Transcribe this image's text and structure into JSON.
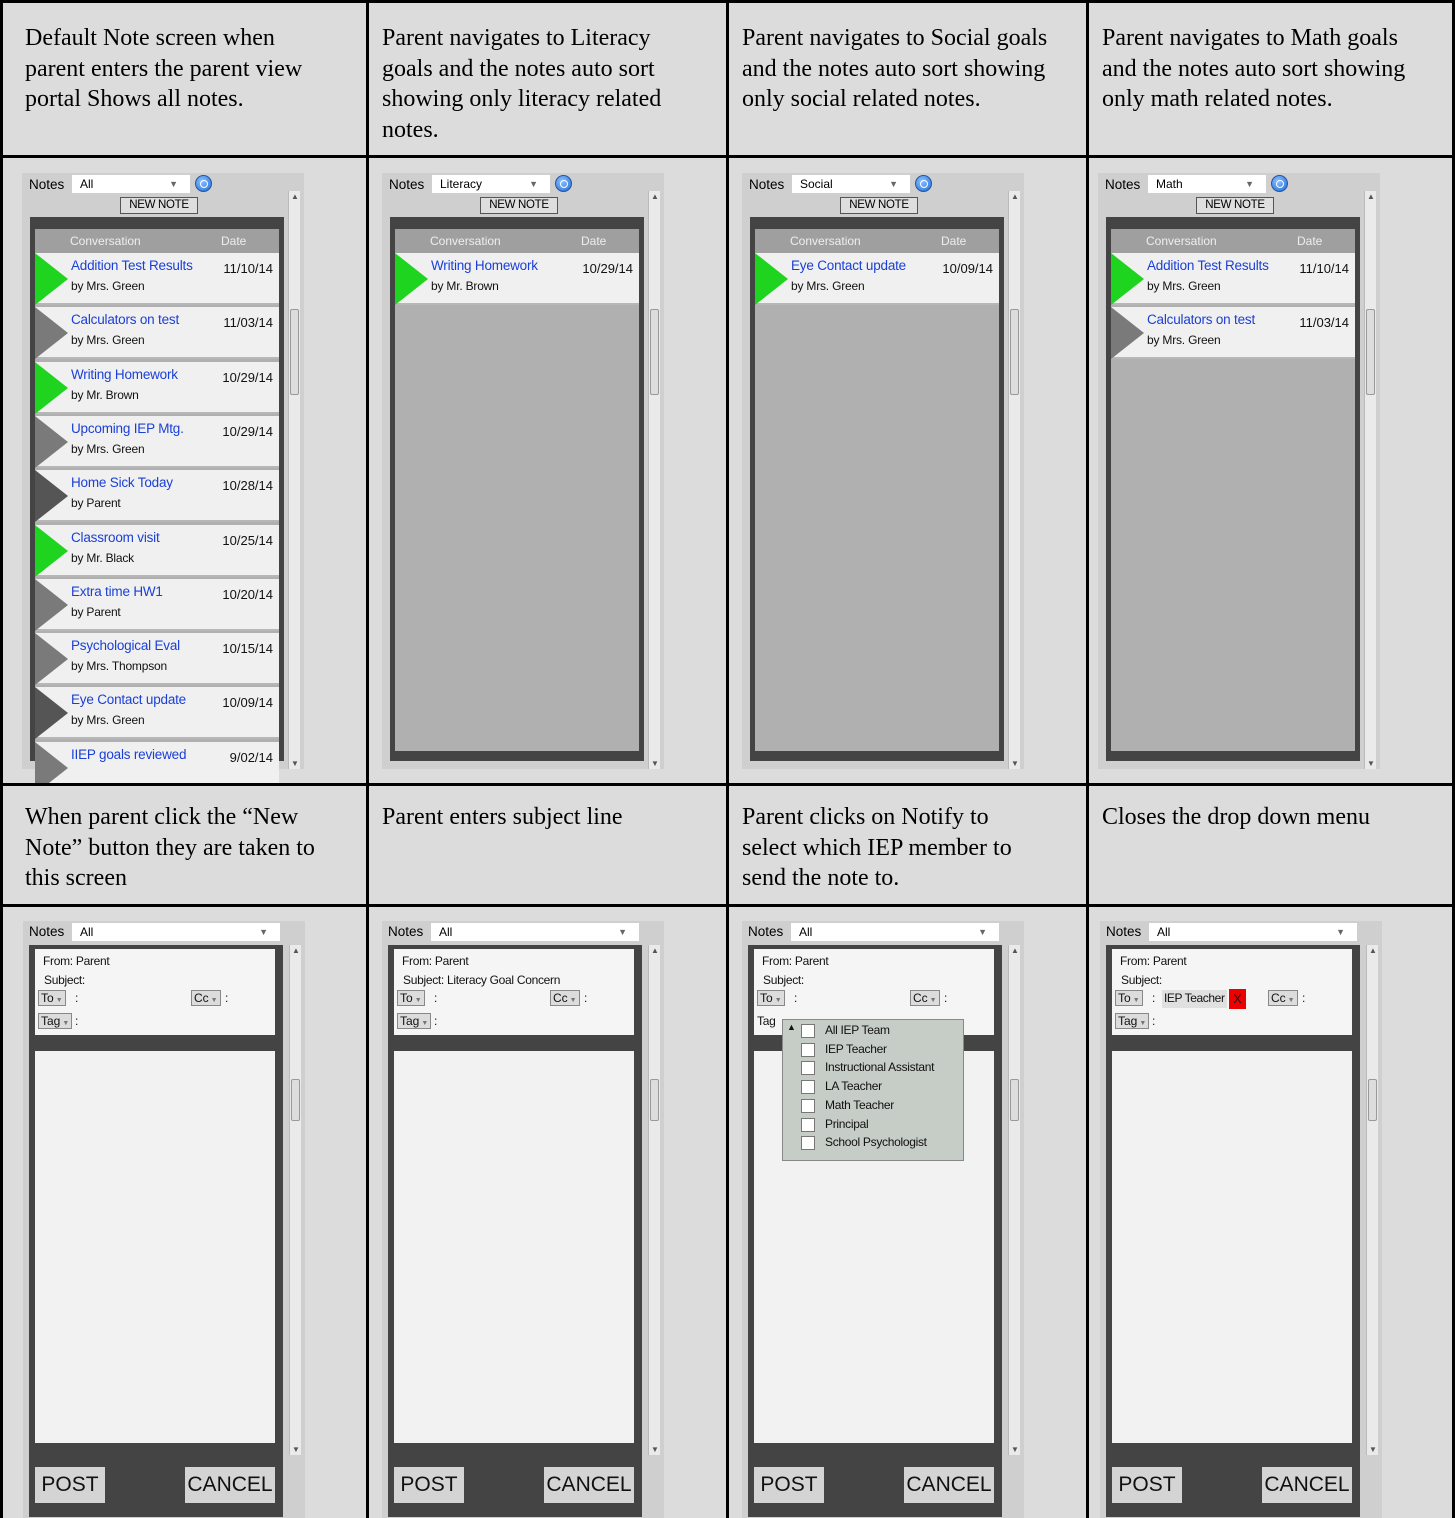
{
  "captions": [
    "Default Note screen when parent enters the parent view portal Shows all notes.",
    "Parent navigates to Literacy goals and the notes  auto sort showing only literacy related notes.",
    "Parent navigates to Social goals and the notes  auto sort showing only social related notes.",
    "Parent navigates to Math goals and the notes  auto sort showing only math related notes.",
    "When parent click the “New Note” button they are taken to this screen",
    "Parent enters subject line",
    "Parent clicks on Notify to select which IEP member to send the note to.",
    "Closes the drop down menu"
  ],
  "ui": {
    "notes_label": "Notes",
    "new_note": "NEW NOTE",
    "col_conversation": "Conversation",
    "col_date": "Date",
    "post": "POST",
    "cancel": "CANCEL",
    "from": "From: Parent",
    "subject_empty": "Subject:",
    "subject_filled": "Subject: Literacy Goal Concern",
    "to": "To",
    "cc": "Cc",
    "tag": "Tag",
    "colon": ":",
    "iep_teacher_chip": "IEP Teacher",
    "remove_x": "X"
  },
  "filters": [
    "All",
    "Literacy",
    "Social",
    "Math"
  ],
  "lists": {
    "all": [
      {
        "title": "Addition Test Results",
        "by": "by Mrs. Green",
        "date": "11/10/14",
        "flag": "green"
      },
      {
        "title": "Calculators on test",
        "by": "by Mrs. Green",
        "date": "11/03/14",
        "flag": "grey"
      },
      {
        "title": "Writing Homework",
        "by": "by Mr. Brown",
        "date": "10/29/14",
        "flag": "green"
      },
      {
        "title": "Upcoming IEP Mtg.",
        "by": "by Mrs.  Green",
        "date": "10/29/14",
        "flag": "grey"
      },
      {
        "title": "Home Sick Today",
        "by": "by Parent",
        "date": "10/28/14",
        "flag": "dark"
      },
      {
        "title": "Classroom visit",
        "by": "by Mr. Black",
        "date": "10/25/14",
        "flag": "green"
      },
      {
        "title": "Extra time HW1",
        "by": "by Parent",
        "date": "10/20/14",
        "flag": "grey"
      },
      {
        "title": "Psychological Eval",
        "by": "by Mrs. Thompson",
        "date": "10/15/14",
        "flag": "grey"
      },
      {
        "title": "Eye Contact update",
        "by": "by Mrs.  Green",
        "date": "10/09/14",
        "flag": "dark"
      },
      {
        "title": "IIEP goals reviewed",
        "by": "",
        "date": "9/02/14",
        "flag": "grey"
      }
    ],
    "literacy": [
      {
        "title": "Writing Homework",
        "by": "by Mr. Brown",
        "date": "10/29/14",
        "flag": "green"
      }
    ],
    "social": [
      {
        "title": "Eye Contact update",
        "by": "by Mrs.  Green",
        "date": "10/09/14",
        "flag": "green"
      }
    ],
    "math": [
      {
        "title": "Addition Test Results",
        "by": "by Mrs. Green",
        "date": "11/10/14",
        "flag": "green"
      },
      {
        "title": "Calculators on test",
        "by": "by Mrs. Green",
        "date": "11/03/14",
        "flag": "grey"
      }
    ]
  },
  "notify_options": [
    "All IEP Team",
    "IEP Teacher",
    "Instructional Assistant",
    "LA Teacher",
    "Math Teacher",
    "Principal",
    "School Psychologist"
  ]
}
